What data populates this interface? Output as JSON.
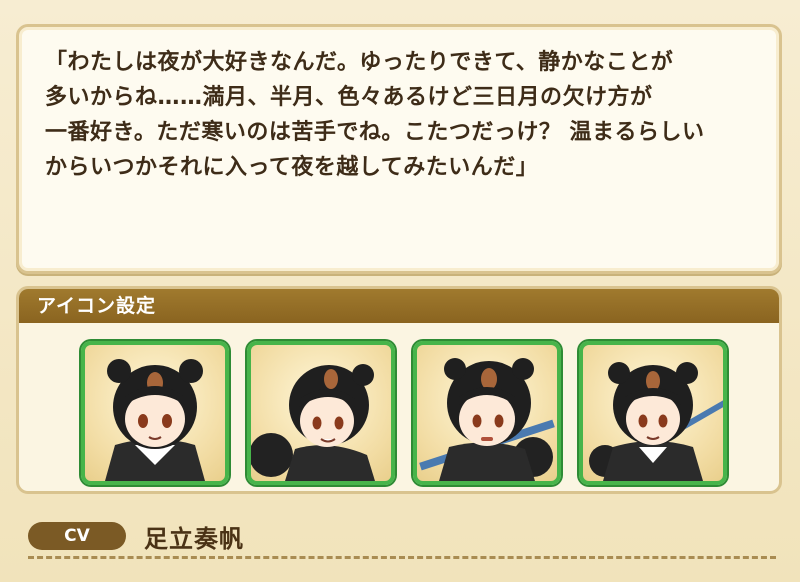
{
  "quote": {
    "text": "「わたしは夜が大好きなんだ。ゆったりできて、静かなことが\n多いからね……満月、半月、色々あるけど三日月の欠け方が\n一番好き。ただ寒いのは苦手でね。こたつだっけ？ 温まるらしい\nからいつかそれに入って夜を越してみたいんだ」"
  },
  "icon_settings": {
    "header": "アイコン設定",
    "icons": [
      {
        "name": "icon-1"
      },
      {
        "name": "icon-2"
      },
      {
        "name": "icon-3"
      },
      {
        "name": "icon-4"
      }
    ]
  },
  "cv": {
    "label": "CV",
    "name": "足立奏帆"
  },
  "colors": {
    "accent_border": "#47b44a",
    "header_bg": "#8a6420",
    "text": "#3e2c18"
  }
}
